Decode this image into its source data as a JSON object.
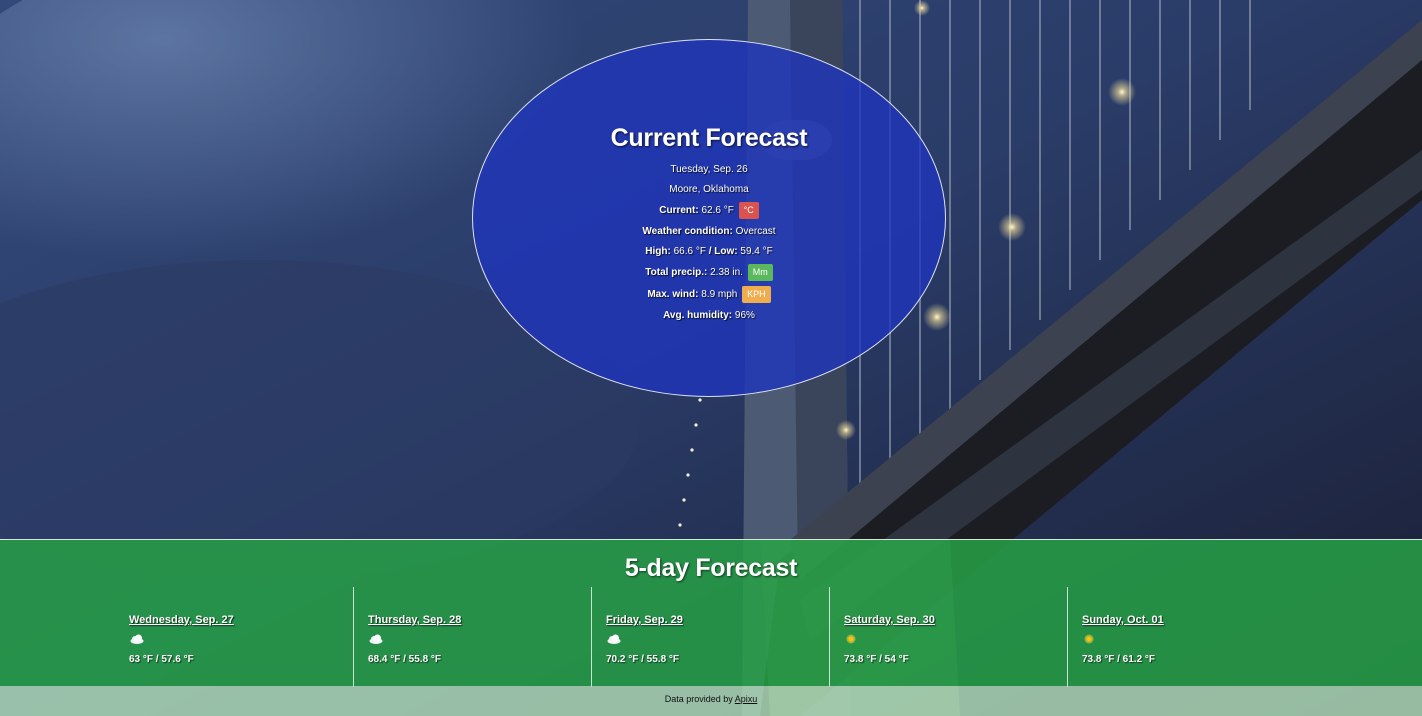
{
  "current": {
    "title": "Current Forecast",
    "date": "Tuesday, Sep. 26",
    "location": "Moore, Oklahoma",
    "current_label": "Current:",
    "current_value": "62.6 °F",
    "current_toggle": "°C",
    "condition_label": "Weather condition:",
    "condition_value": "Overcast",
    "high_label": "High:",
    "high_value": "66.6 °F",
    "low_label": "/ Low:",
    "low_value": "59.4 °F",
    "precip_label": "Total precip.:",
    "precip_value": "2.38 in.",
    "precip_toggle": "Mm",
    "wind_label": "Max. wind:",
    "wind_value": "8.9 mph",
    "wind_toggle": "KPH",
    "humidity_label": "Avg. humidity:",
    "humidity_value": "96%"
  },
  "toggle_colors": {
    "temp": "#d9534f",
    "precip": "#5cb85c",
    "wind": "#f0ad4e"
  },
  "five_day": {
    "title": "5-day Forecast",
    "days": [
      {
        "date": "Wednesday, Sep. 27",
        "icon": "cloud-icon",
        "temps": "63 °F / 57.6 °F"
      },
      {
        "date": "Thursday, Sep. 28",
        "icon": "cloud-icon",
        "temps": "68.4 °F / 55.8 °F"
      },
      {
        "date": "Friday, Sep. 29",
        "icon": "cloud-icon",
        "temps": "70.2 °F / 55.8 °F"
      },
      {
        "date": "Saturday, Sep. 30",
        "icon": "sun-icon",
        "temps": "73.8 °F / 54 °F"
      },
      {
        "date": "Sunday, Oct. 01",
        "icon": "sun-icon",
        "temps": "73.8 °F / 61.2 °F"
      }
    ]
  },
  "footer": {
    "text": "Data provided by",
    "link": "Apixu"
  }
}
